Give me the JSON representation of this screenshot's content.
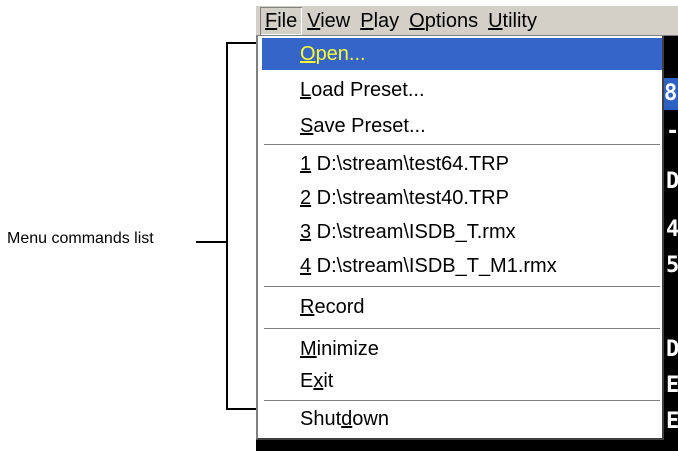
{
  "annotation": {
    "label": "Menu commands list"
  },
  "menubar": {
    "items": [
      {
        "label": "File",
        "mnemonic": "F",
        "rest": "ile"
      },
      {
        "label": "View",
        "mnemonic": "V",
        "rest": "iew"
      },
      {
        "label": "Play",
        "mnemonic": "P",
        "rest": "lay"
      },
      {
        "label": "Options",
        "mnemonic": "O",
        "rest": "ptions"
      },
      {
        "label": "Utility",
        "mnemonic": "U",
        "rest": "tility"
      }
    ]
  },
  "file_menu": {
    "open": {
      "label": "Open...",
      "mnemonic": "O",
      "rest": "pen..."
    },
    "load_preset": {
      "label": "Load Preset...",
      "mnemonic": "L",
      "rest": "oad Preset..."
    },
    "save_preset": {
      "label": "Save Preset...",
      "mnemonic": "S",
      "rest": "ave Preset..."
    },
    "recent": [
      {
        "num": "1",
        "path": " D:\\stream\\test64.TRP"
      },
      {
        "num": "2",
        "path": " D:\\stream\\test40.TRP"
      },
      {
        "num": "3",
        "path": " D:\\stream\\ISDB_T.rmx"
      },
      {
        "num": "4",
        "path": " D:\\stream\\ISDB_T_M1.rmx"
      }
    ],
    "record": {
      "label": "Record",
      "mnemonic": "R",
      "rest": "ecord"
    },
    "minimize": {
      "label": "Minimize",
      "mnemonic": "M",
      "rest": "inimize"
    },
    "exit": {
      "label": "Exit",
      "pre": "E",
      "mnemonic": "x",
      "rest": "it"
    },
    "shutdown": {
      "label": "Shutdown",
      "pre": "Shut",
      "mnemonic": "d",
      "rest": "own"
    }
  },
  "background_app": {
    "fragments": [
      "8",
      "-",
      "D",
      "4",
      "5",
      "D",
      "E",
      "E"
    ]
  },
  "colors": {
    "selection_bg": "#3565c9",
    "selection_text": "#ffff33",
    "menu_bg": "#ffffff",
    "menubar_bg": "#d4d0c8"
  }
}
